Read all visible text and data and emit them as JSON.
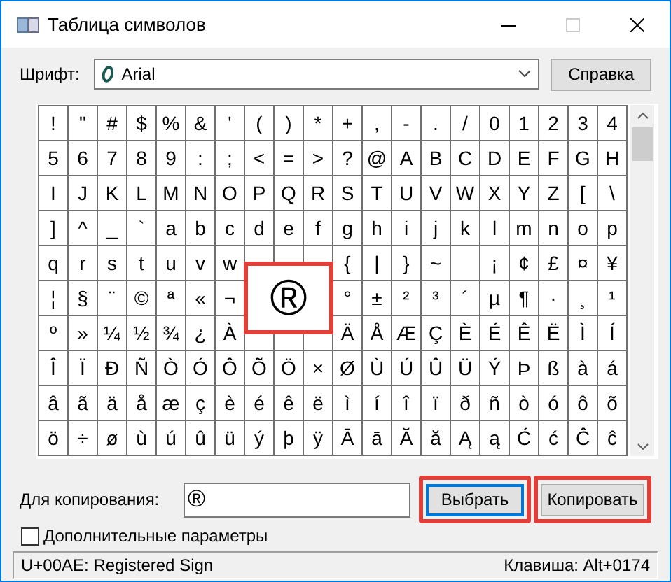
{
  "window": {
    "title": "Таблица символов",
    "maximize_disabled": true
  },
  "font": {
    "label": "Шрифт:",
    "value": "Arial",
    "help_button": "Справка"
  },
  "grid": [
    [
      "!",
      "\"",
      "#",
      "$",
      "%",
      "&",
      "'",
      "(",
      ")",
      "*",
      "+",
      ",",
      "-",
      ".",
      "/",
      "0",
      "1",
      "2",
      "3",
      "4"
    ],
    [
      "5",
      "6",
      "7",
      "8",
      "9",
      ":",
      ";",
      "<",
      "=",
      ">",
      "?",
      "@",
      "A",
      "B",
      "C",
      "D",
      "E",
      "F",
      "G",
      "H"
    ],
    [
      "I",
      "J",
      "K",
      "L",
      "M",
      "N",
      "O",
      "P",
      "Q",
      "R",
      "S",
      "T",
      "U",
      "V",
      "W",
      "X",
      "Y",
      "Z",
      "[",
      "\\"
    ],
    [
      "]",
      "^",
      "_",
      "`",
      "a",
      "b",
      "c",
      "d",
      "e",
      "f",
      "g",
      "h",
      "i",
      "j",
      "k",
      "l",
      "m",
      "n",
      "o",
      "p"
    ],
    [
      "q",
      "r",
      "s",
      "t",
      "u",
      "v",
      "w",
      {
        "kind": "blank"
      },
      {
        "kind": "blank"
      },
      {
        "kind": "blank"
      },
      "{",
      "|",
      "}",
      "~",
      {
        "kind": "blank"
      },
      "¡",
      "¢",
      "£",
      "¤",
      "¥"
    ],
    [
      "¦",
      "§",
      "¨",
      "©",
      "ª",
      "«",
      "¬",
      {
        "kind": "blank"
      },
      {
        "kind": "selected"
      },
      {
        "kind": "blank"
      },
      "°",
      "±",
      "²",
      "³",
      "´",
      "µ",
      "¶",
      "·",
      "¸",
      "¹"
    ],
    [
      "º",
      "»",
      "¼",
      "½",
      "¾",
      "¿",
      "À",
      {
        "kind": "blank"
      },
      {
        "kind": "blank"
      },
      {
        "kind": "blank"
      },
      "Ä",
      "Å",
      "Æ",
      "Ç",
      "È",
      "É",
      "Ê",
      "Ë",
      "Ì",
      "Í"
    ],
    [
      "Î",
      "Ï",
      "Ð",
      "Ñ",
      "Ò",
      "Ó",
      "Ô",
      "Õ",
      "Ö",
      "×",
      "Ø",
      "Ù",
      "Ú",
      "Û",
      "Ü",
      "Ý",
      "Þ",
      "ß",
      "à",
      "á"
    ],
    [
      "â",
      "ã",
      "ä",
      "å",
      "æ",
      "ç",
      "è",
      "é",
      "ê",
      "ë",
      "ì",
      "í",
      "î",
      "ï",
      "ð",
      "ñ",
      "ò",
      "ó",
      "ô",
      "õ"
    ],
    [
      "ö",
      "÷",
      "ø",
      "ù",
      "ú",
      "û",
      "ü",
      "ý",
      "þ",
      "ÿ",
      "Ā",
      "ā",
      "Ă",
      "ă",
      "Ą",
      "ą",
      "Ć",
      "ć",
      "Ĉ",
      "ĉ"
    ]
  ],
  "selection": {
    "char": "®",
    "highlighted": true
  },
  "copy": {
    "label": "Для копирования:",
    "value": "®",
    "select_button": {
      "label": "Выбрать",
      "highlighted": true,
      "focused": true
    },
    "copy_button": {
      "label": "Копировать",
      "highlighted": true
    }
  },
  "advanced": {
    "label": "Дополнительные параметры",
    "checked": false
  },
  "status_bar": {
    "left": "U+00AE: Registered Sign",
    "right": "Клавиша: Alt+0174"
  }
}
